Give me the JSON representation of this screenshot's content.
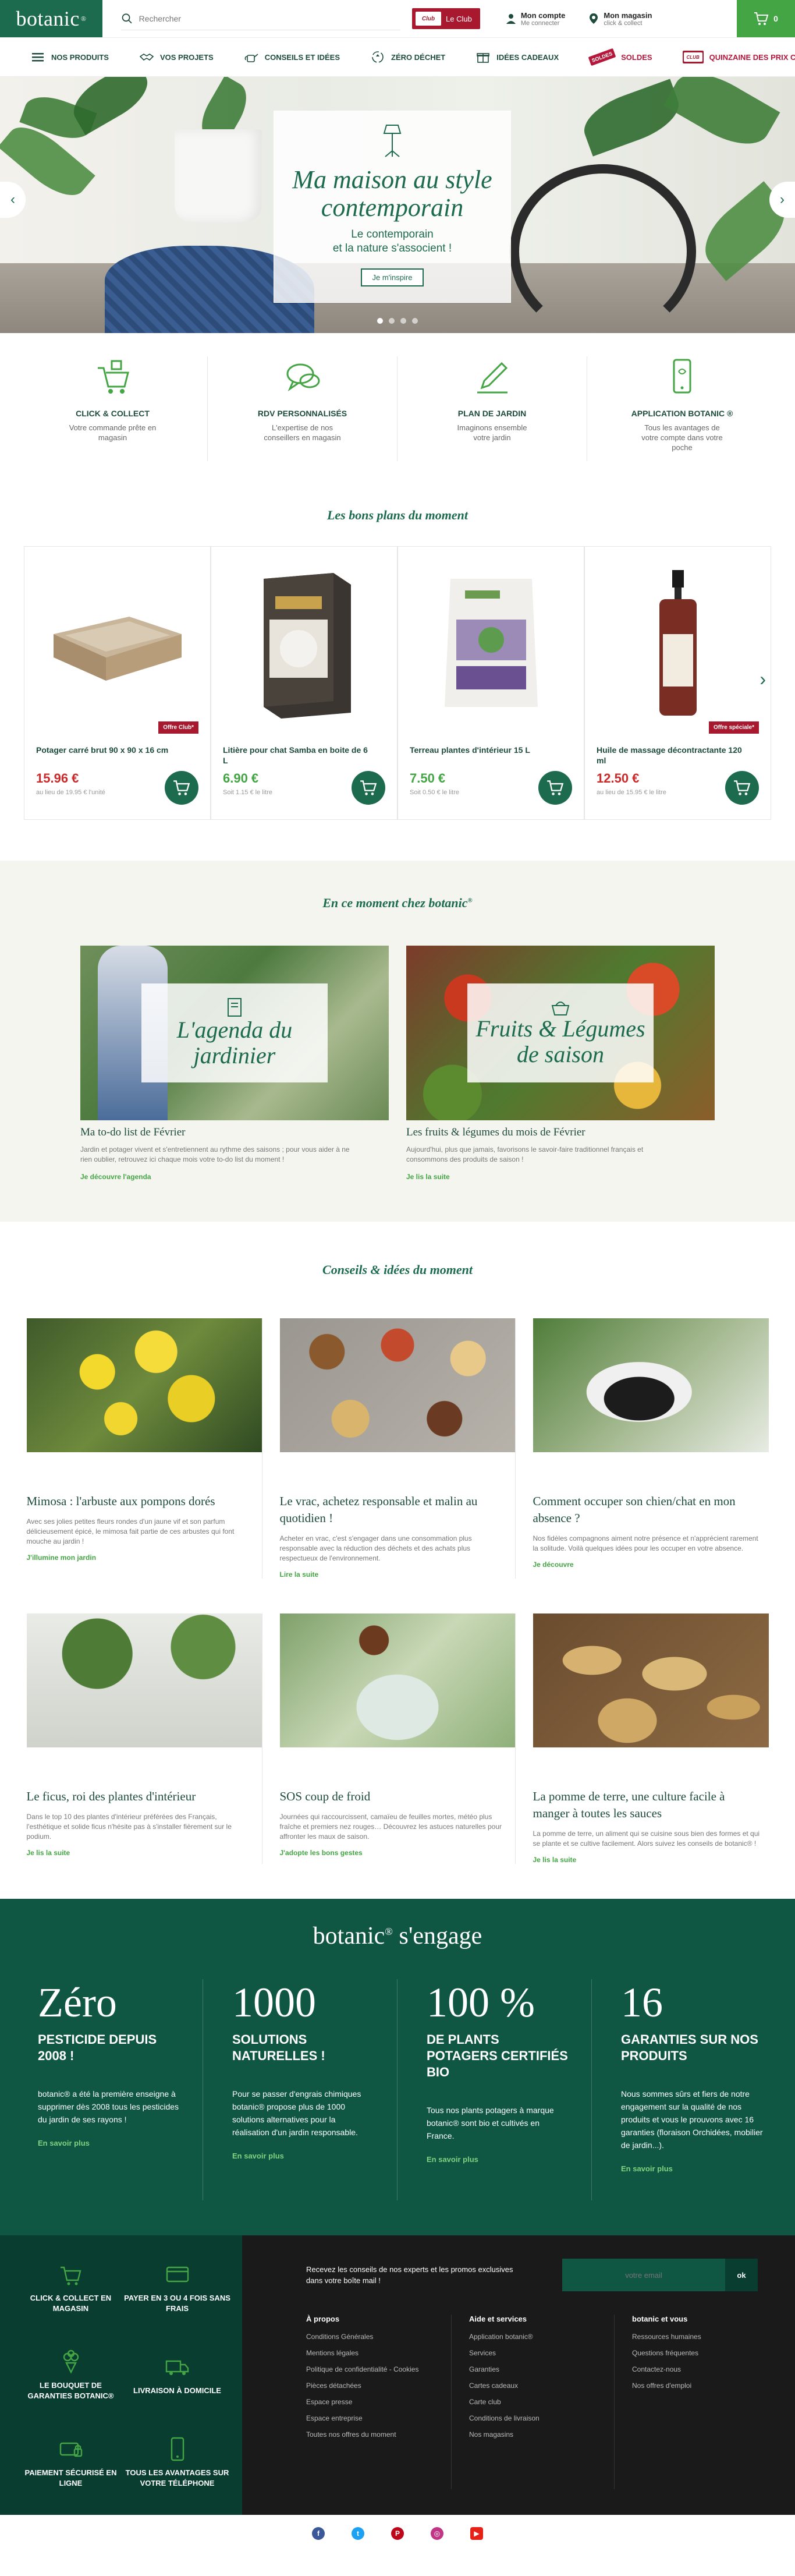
{
  "header": {
    "logo": "botanic",
    "logo_mark": "®",
    "search_placeholder": "Rechercher",
    "club_card": "Club",
    "club_label": "Le Club",
    "account_title": "Mon compte",
    "account_sub": "Me connecter",
    "store_title": "Mon magasin",
    "store_sub": "click & collect",
    "cart_count": "0"
  },
  "nav": [
    {
      "label": "NOS PRODUITS",
      "icon": "hamburger-icon"
    },
    {
      "label": "VOS PROJETS",
      "icon": "handshake-icon"
    },
    {
      "label": "CONSEILS ET IDÉES",
      "icon": "watering-can-icon"
    },
    {
      "label": "ZÉRO DÉCHET",
      "icon": "recycle-icon"
    },
    {
      "label": "IDÉES CADEAUX",
      "icon": "gift-icon"
    },
    {
      "label": "SOLDES",
      "icon": "sale-tag-icon",
      "tag": "SOLDES"
    },
    {
      "label": "QUINZAINE DES PRIX CLUB",
      "icon": "club-card-icon",
      "tag": "Club"
    }
  ],
  "hero": {
    "title": "Ma maison au style contemporain",
    "subtitle1": "Le contemporain",
    "subtitle2": "et la nature s'associent !",
    "button": "Je m'inspire",
    "prev": "‹",
    "next": "›"
  },
  "services": [
    {
      "title": "CLICK & COLLECT",
      "text": "Votre commande prête en magasin",
      "icon": "cart-icon"
    },
    {
      "title": "RDV PERSONNALISÉS",
      "text": "L'expertise de nos conseillers en magasin",
      "icon": "chat-bubbles-icon"
    },
    {
      "title": "PLAN DE JARDIN",
      "text": "Imaginons ensemble votre jardin",
      "icon": "pencil-icon"
    },
    {
      "title": "APPLICATION BOTANIC ®",
      "text": "Tous les avantages de votre compte dans votre poche",
      "icon": "smartphone-icon"
    }
  ],
  "deals": {
    "title": "Les bons plans du moment",
    "prev": "‹",
    "next": "›",
    "products": [
      {
        "name": "Potager carré brut 90 x 90 x 16 cm",
        "price": "15.96 €",
        "sub": "au lieu de 19.95 € l'unité",
        "offer": "Offre Club*",
        "color": "red"
      },
      {
        "name": "Litière pour chat Samba en boite de 6 L",
        "price": "6.90 €",
        "sub": "Soit 1.15 € le litre",
        "offer": "",
        "color": "green"
      },
      {
        "name": "Terreau plantes d'intérieur 15 L",
        "price": "7.50 €",
        "sub": "Soit 0.50 € le litre",
        "offer": "",
        "color": "green"
      },
      {
        "name": "Huile de massage décontractante 120 ml",
        "price": "12.50 €",
        "sub": "au lieu de 15.95 € le litre",
        "offer": "Offre spéciale*",
        "color": "red"
      }
    ]
  },
  "moment": {
    "title": "En ce moment chez botanic",
    "title_mark": "®",
    "items": [
      {
        "overlay": "L'agenda du jardinier",
        "title": "Ma to-do list de Février",
        "text": "Jardin et potager vivent et s'entretiennent au rythme des saisons ; pour vous aider à ne rien oublier, retrouvez ici chaque mois votre to-do list du moment !",
        "more": "Je découvre l'agenda"
      },
      {
        "overlay": "Fruits & Légumes de saison",
        "title": "Les fruits & légumes du mois de Février",
        "text": "Aujourd'hui, plus que jamais, favorisons le savoir-faire traditionnel français et consommons des produits de saison !",
        "more": "Je lis la suite"
      }
    ]
  },
  "conseils": {
    "title": "Conseils & idées du moment",
    "items": [
      {
        "title": "Mimosa : l'arbuste aux pompons dorés",
        "text": "Avec ses jolies petites fleurs rondes d'un jaune vif et son parfum délicieusement épicé, le mimosa fait partie de ces arbustes qui font mouche au jardin !",
        "more": "J'illumine mon jardin"
      },
      {
        "title": "Le vrac, achetez responsable et malin au quotidien !",
        "text": "Acheter en vrac, c'est s'engager dans une consommation plus responsable avec la réduction des déchets et des achats plus respectueux de l'environnement.",
        "more": "Lire la suite"
      },
      {
        "title": "Comment occuper son chien/chat en mon absence ?",
        "text": "Nos fidèles compagnons aiment notre présence et n'apprécient rarement la solitude. Voilà quelques idées pour les occuper en votre absence.",
        "more": "Je découvre"
      },
      {
        "title": "Le ficus, roi des plantes d'intérieur",
        "text": "Dans le top 10 des plantes d'intérieur préférées des Français, l'esthétique et solide ficus n'hésite pas à s'installer fièrement sur le podium.",
        "more": "Je lis la suite"
      },
      {
        "title": "SOS coup de froid",
        "text": "Journées qui raccourcissent, camaïeu de feuilles mortes, météo plus fraîche et premiers nez rouges… Découvrez les astuces naturelles pour affronter les maux de saison.",
        "more": "J'adopte les bons gestes"
      },
      {
        "title": "La pomme de terre, une culture facile à manger à toutes les sauces",
        "text": "La pomme de terre, un aliment qui se cuisine sous bien des formes et qui se plante et se cultive facilement. Alors suivez les conseils de botanic® !",
        "more": "Je lis la suite"
      }
    ]
  },
  "engage": {
    "title": "botanic",
    "title_mark": "®",
    "title_rest": " s'engage",
    "items": [
      {
        "big": "Zéro",
        "head": "PESTICIDE DEPUIS 2008 !",
        "text": "botanic® a été la première enseigne à supprimer dès 2008 tous les pesticides du jardin de ses rayons !",
        "more": "En savoir plus"
      },
      {
        "big": "1000",
        "head": "SOLUTIONS NATURELLES !",
        "text": "Pour se passer d'engrais chimiques botanic® propose plus de 1000 solutions alternatives pour la réalisation d'un jardin responsable.",
        "more": "En savoir plus"
      },
      {
        "big": "100 %",
        "head": "DE PLANTS POTAGERS CERTIFIÉS BIO",
        "text": "Tous nos plants potagers à marque botanic® sont bio et cultivés en France.",
        "more": "En savoir plus"
      },
      {
        "big": "16",
        "head": "GARANTIES SUR NOS PRODUITS",
        "text": "Nous sommes sûrs et fiers de notre engagement sur la qualité de nos produits et vous le prouvons avec 16 garanties (floraison Orchidées, mobilier de jardin...).",
        "more": "En savoir plus"
      }
    ]
  },
  "footer": {
    "features": [
      {
        "label": "CLICK & COLLECT EN MAGASIN",
        "icon": "store-cart-icon"
      },
      {
        "label": "PAYER EN 3 OU 4 FOIS SANS FRAIS",
        "icon": "credit-card-icon"
      },
      {
        "label": "LE BOUQUET DE GARANTIES BOTANIC®",
        "icon": "bouquet-icon"
      },
      {
        "label": "LIVRAISON À DOMICILE",
        "icon": "truck-icon"
      },
      {
        "label": "PAIEMENT SÉCURISÉ EN LIGNE",
        "icon": "secure-payment-icon"
      },
      {
        "label": "TOUS LES AVANTAGES SUR VOTRE TÉLÉPHONE",
        "icon": "phone-icon"
      }
    ],
    "newsletter_text": "Recevez les conseils de nos experts et les promos exclusives dans votre boîte mail !",
    "newsletter_placeholder": "votre email",
    "newsletter_button": "ok",
    "cols": [
      {
        "title": "À propos",
        "links": [
          "Conditions Générales",
          "Mentions légales",
          "Politique de confidentialité - Cookies",
          "Pièces détachées",
          "Espace presse",
          "Espace entreprise",
          "Toutes nos offres du moment"
        ]
      },
      {
        "title": "Aide et services",
        "links": [
          "Application botanic®",
          "Services",
          "Garanties",
          "Cartes cadeaux",
          "Carte club",
          "Conditions de livraison",
          "Nos magasins"
        ]
      },
      {
        "title": "botanic et vous",
        "links": [
          "Ressources humaines",
          "Questions fréquentes",
          "Contactez-nous",
          "Nos offres d'emploi"
        ]
      }
    ],
    "social": [
      "f",
      "t",
      "P",
      "◎",
      "▶"
    ]
  },
  "colors": {
    "brand_green": "#1d6b4f",
    "accent_red": "#a8192f",
    "cta_green": "#44a544",
    "engage_bg": "#0f5743"
  }
}
